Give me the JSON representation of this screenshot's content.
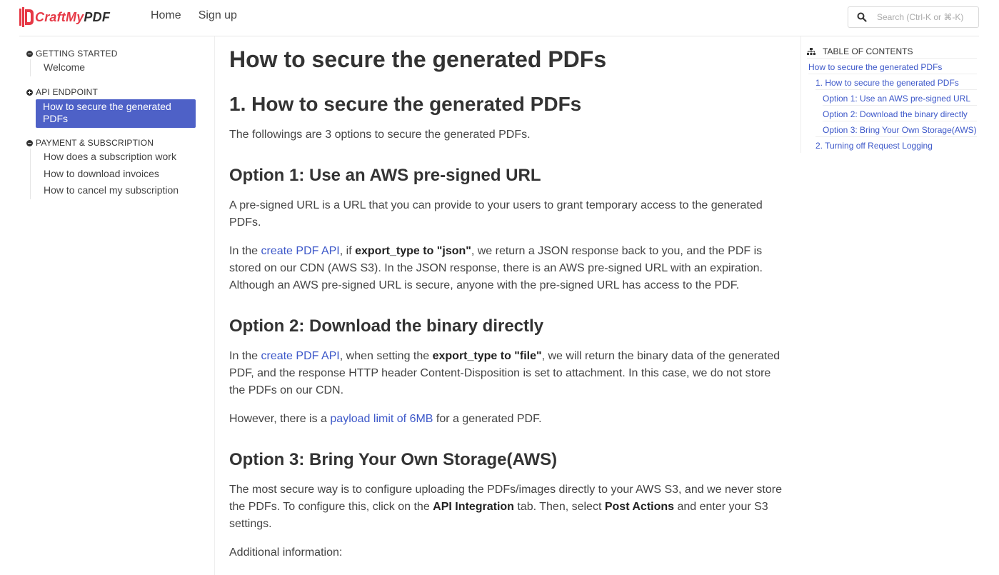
{
  "header": {
    "logo": {
      "craft": "CraftMy",
      "pdf": "PDF",
      "accent": "#e63946"
    },
    "nav": [
      {
        "label": "Home"
      },
      {
        "label": "Sign up"
      }
    ],
    "search": {
      "placeholder": "Search (Ctrl-K or ⌘-K)",
      "icon": "search-icon"
    }
  },
  "sidebar": {
    "sections": [
      {
        "title": "GETTING STARTED",
        "icon": "minus-circle-icon",
        "items": [
          {
            "label": "Welcome"
          }
        ]
      },
      {
        "title": "API ENDPOINT",
        "icon": "plus-circle-icon",
        "items": [
          {
            "label": "How to secure the generated PDFs",
            "active": true
          }
        ]
      },
      {
        "title": "PAYMENT & SUBSCRIPTION",
        "icon": "minus-circle-icon",
        "items": [
          {
            "label": "How does a subscription work"
          },
          {
            "label": "How to download invoices"
          },
          {
            "label": "How to cancel my subscription"
          }
        ]
      }
    ],
    "active_color": "#4e61c7"
  },
  "article": {
    "title": "How to secure the generated PDFs",
    "h2": "1. How to secure the generated PDFs",
    "intro": "The followings are 3 options to secure the generated PDFs.",
    "option1": {
      "heading": "Option 1: Use an AWS pre-signed URL",
      "p1": "A pre-signed URL is a URL that you can provide to your users to grant temporary access to the generated PDFs.",
      "p2_a": "In the ",
      "p2_link": "create PDF API",
      "p2_b": ", if ",
      "p2_bold": "export_type to \"json\"",
      "p2_c": ", we return a JSON response back to you, and the PDF is stored on our CDN (AWS S3). In the JSON response, there is an AWS pre-signed URL with an expiration. Although an AWS pre-signed URL is secure, anyone with the pre-signed URL has access to the PDF."
    },
    "option2": {
      "heading": "Option 2: Download the binary directly",
      "p1_a": "In the ",
      "p1_link": "create PDF API",
      "p1_b": ", when setting the ",
      "p1_bold": "export_type to \"file\"",
      "p1_c": ", we will return the binary data of the generated PDF, and the response HTTP header Content-Disposition is set to attachment. In this case, we do not store the PDFs on our CDN.",
      "p2_a": "However, there is a ",
      "p2_link": "payload limit of 6MB",
      "p2_b": " for a generated PDF."
    },
    "option3": {
      "heading": "Option 3: Bring Your Own Storage(AWS)",
      "p1_a": "The most secure way is to configure uploading the PDFs/images directly to your AWS S3, and we never store the PDFs. To configure this, click on the ",
      "p1_bold1": "API Integration",
      "p1_b": " tab. Then, select ",
      "p1_bold2": "Post Actions",
      "p1_c": " and enter your S3 settings.",
      "p2": "Additional information:"
    },
    "link_color": "#3d58c9"
  },
  "toc": {
    "title": "TABLE OF CONTENTS",
    "icon": "sitemap-icon",
    "items": [
      {
        "label": "How to secure the generated PDFs",
        "level": 0
      },
      {
        "label": "1. How to secure the generated PDFs",
        "level": 1
      },
      {
        "label": "Option 1: Use an AWS pre-signed URL",
        "level": 2
      },
      {
        "label": "Option 2: Download the binary directly",
        "level": 2
      },
      {
        "label": "Option 3: Bring Your Own Storage(AWS)",
        "level": 2
      },
      {
        "label": "2. Turning off Request Logging",
        "level": 1
      }
    ]
  }
}
